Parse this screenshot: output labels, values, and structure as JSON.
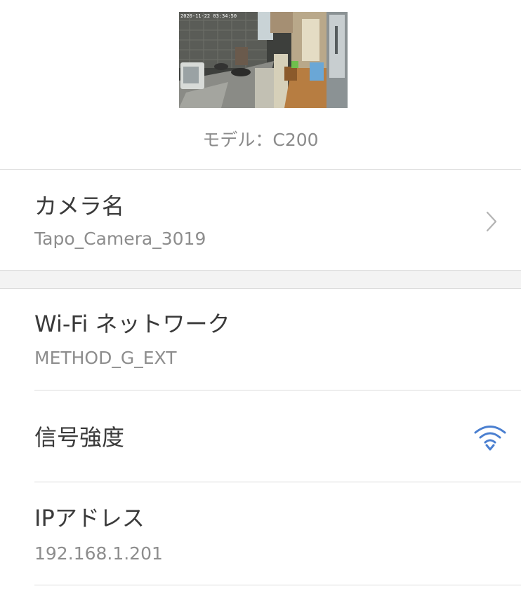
{
  "camera_preview": {
    "timestamp": "2020-11-22 03:34:50"
  },
  "model": {
    "label": "モデル：C200"
  },
  "rows": {
    "camera_name": {
      "title": "カメラ名",
      "value": "Tapo_Camera_3019"
    },
    "wifi_network": {
      "title": "Wi-Fi ネットワーク",
      "value": "METHOD_G_EXT"
    },
    "signal_strength": {
      "title": "信号強度",
      "icon": "wifi-signal-icon",
      "icon_color": "#4a7fd0"
    },
    "ip_address": {
      "title": "IPアドレス",
      "value": "192.168.1.201"
    }
  }
}
